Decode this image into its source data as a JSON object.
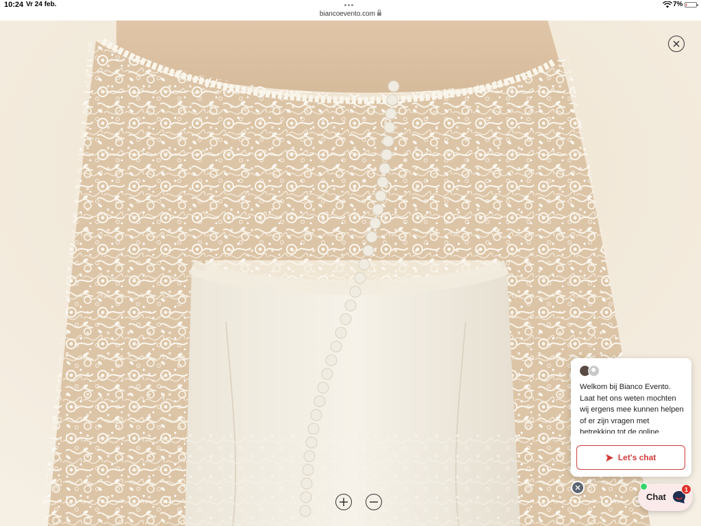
{
  "status_bar": {
    "time": "10:24",
    "date": "Vr 24 feb.",
    "url": "biancoevento.com",
    "battery_percent": "7%",
    "battery_level": 0.07
  },
  "viewer": {
    "photo_subject": "lace-back-wedding-dress",
    "close_icon": "close-icon",
    "zoom_in_icon": "plus-icon",
    "zoom_out_icon": "minus-icon"
  },
  "chat_widget": {
    "welcome_text": "Welkom bij Bianco Evento. Laat het ons weten mochten wij ergens mee kunnen helpen of er zijn vragen met betrekking tot de online",
    "cta_label": "Let's chat",
    "launcher_label": "Chat",
    "unread_badge": "1",
    "accent_color": "#d23b3b",
    "online_color": "#36d36a"
  }
}
